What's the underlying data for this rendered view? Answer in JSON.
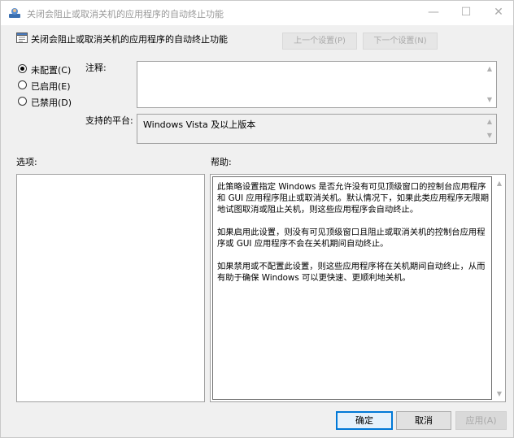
{
  "window": {
    "title": "关闭会阻止或取消关机的应用程序的自动终止功能",
    "minimize_glyph": "—",
    "maximize_glyph": "☐",
    "close_glyph": "✕"
  },
  "header": {
    "policy_title": "关闭会阻止或取消关机的应用程序的自动终止功能",
    "prev_label": "上一个设置(P)",
    "next_label": "下一个设置(N)"
  },
  "state": {
    "options": [
      {
        "label": "未配置(C)",
        "checked": true
      },
      {
        "label": "已启用(E)",
        "checked": false
      },
      {
        "label": "已禁用(D)",
        "checked": false
      }
    ]
  },
  "comment": {
    "label": "注释:",
    "value": ""
  },
  "platform": {
    "label": "支持的平台:",
    "value": "Windows Vista 及以上版本"
  },
  "options_section": {
    "label": "选项:"
  },
  "help_section": {
    "label": "帮助:",
    "paragraphs": [
      "此策略设置指定 Windows 是否允许没有可见顶级窗口的控制台应用程序和 GUI 应用程序阻止或取消关机。默认情况下，如果此类应用程序无限期地试图取消或阻止关机，则这些应用程序会自动终止。",
      "如果启用此设置，则没有可见顶级窗口且阻止或取消关机的控制台应用程序或 GUI 应用程序不会在关机期间自动终止。",
      "如果禁用或不配置此设置，则这些应用程序将在关机期间自动终止，从而有助于确保 Windows 可以更快速、更顺利地关机。"
    ]
  },
  "footer": {
    "ok_label": "确定",
    "cancel_label": "取消",
    "apply_label": "应用(A)"
  },
  "icons": {
    "app": "group-policy-icon",
    "policy": "policy-setting-icon"
  },
  "colors": {
    "accent": "#0078d7",
    "disabled_text": "#a9a9a9"
  }
}
